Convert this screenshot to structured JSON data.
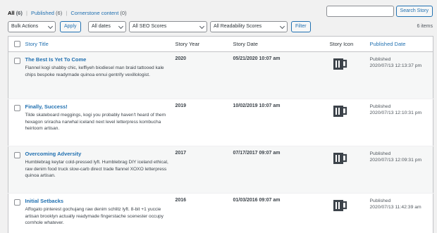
{
  "filters": {
    "all_label": "All",
    "all_count": "(6)",
    "published_label": "Published",
    "published_count": "(6)",
    "cornerstone_label": "Cornerstone content",
    "cornerstone_count": "(0)",
    "separator": "|"
  },
  "search": {
    "placeholder": "",
    "button_label": "Search Story"
  },
  "tablenav": {
    "bulk_actions": "Bulk Actions",
    "apply_label": "Apply",
    "dates": "All dates",
    "seo": "All SEO Scores",
    "readability": "All Readability Scores",
    "filter_label": "Filter",
    "items_count": "6 items"
  },
  "columns": {
    "title": "Story Title",
    "year": "Story Year",
    "date": "Story Date",
    "icon": "Story Icon",
    "published": "Published Date"
  },
  "rows": [
    {
      "title": "The Best Is Yet To Come",
      "excerpt": "Flannel kogi shabby chic, keffiyeh biodiesel man braid tattooed kale chips bespoke readymade quinoa ennui gentrify vexillologist.",
      "year": "2020",
      "date": "05/21/2020 10:07 am",
      "icon": "coffee-mug-icon",
      "status": "Published",
      "published": "2020/07/13 12:13:37 pm"
    },
    {
      "title": "Finally, Success!",
      "excerpt": "Tilde skateboard meggings, kogi you probably haven't heard of them hexagon sriracha narwhal iceland next level letterpress kombucha heirloom artisan.",
      "year": "2019",
      "date": "10/02/2019 10:07 am",
      "icon": "coffee-mug-icon",
      "status": "Published",
      "published": "2020/07/13 12:10:31 pm"
    },
    {
      "title": "Overcoming Adversity",
      "excerpt": "Humblebrag keytar cold-pressed lyft. Humblebrag DIY iceland ethical, raw denim food truck slow-carb direct trade flannel XOXO letterpress quinoa artisan.",
      "year": "2017",
      "date": "07/17/2017 09:07 am",
      "icon": "coffee-mug-icon",
      "status": "Published",
      "published": "2020/07/13 12:09:31 pm"
    },
    {
      "title": "Initial Setbacks",
      "excerpt": "Affogato pinterest gochujang raw denim schlitz lyft. 8-bit +1 yuccie artisan brooklyn actually readymade fingerstache scenester occupy cornhole whatever.",
      "year": "2016",
      "date": "01/03/2016 09:07 am",
      "icon": "coffee-mug-icon",
      "status": "Published",
      "published": "2020/07/13 11:42:39 am"
    }
  ]
}
